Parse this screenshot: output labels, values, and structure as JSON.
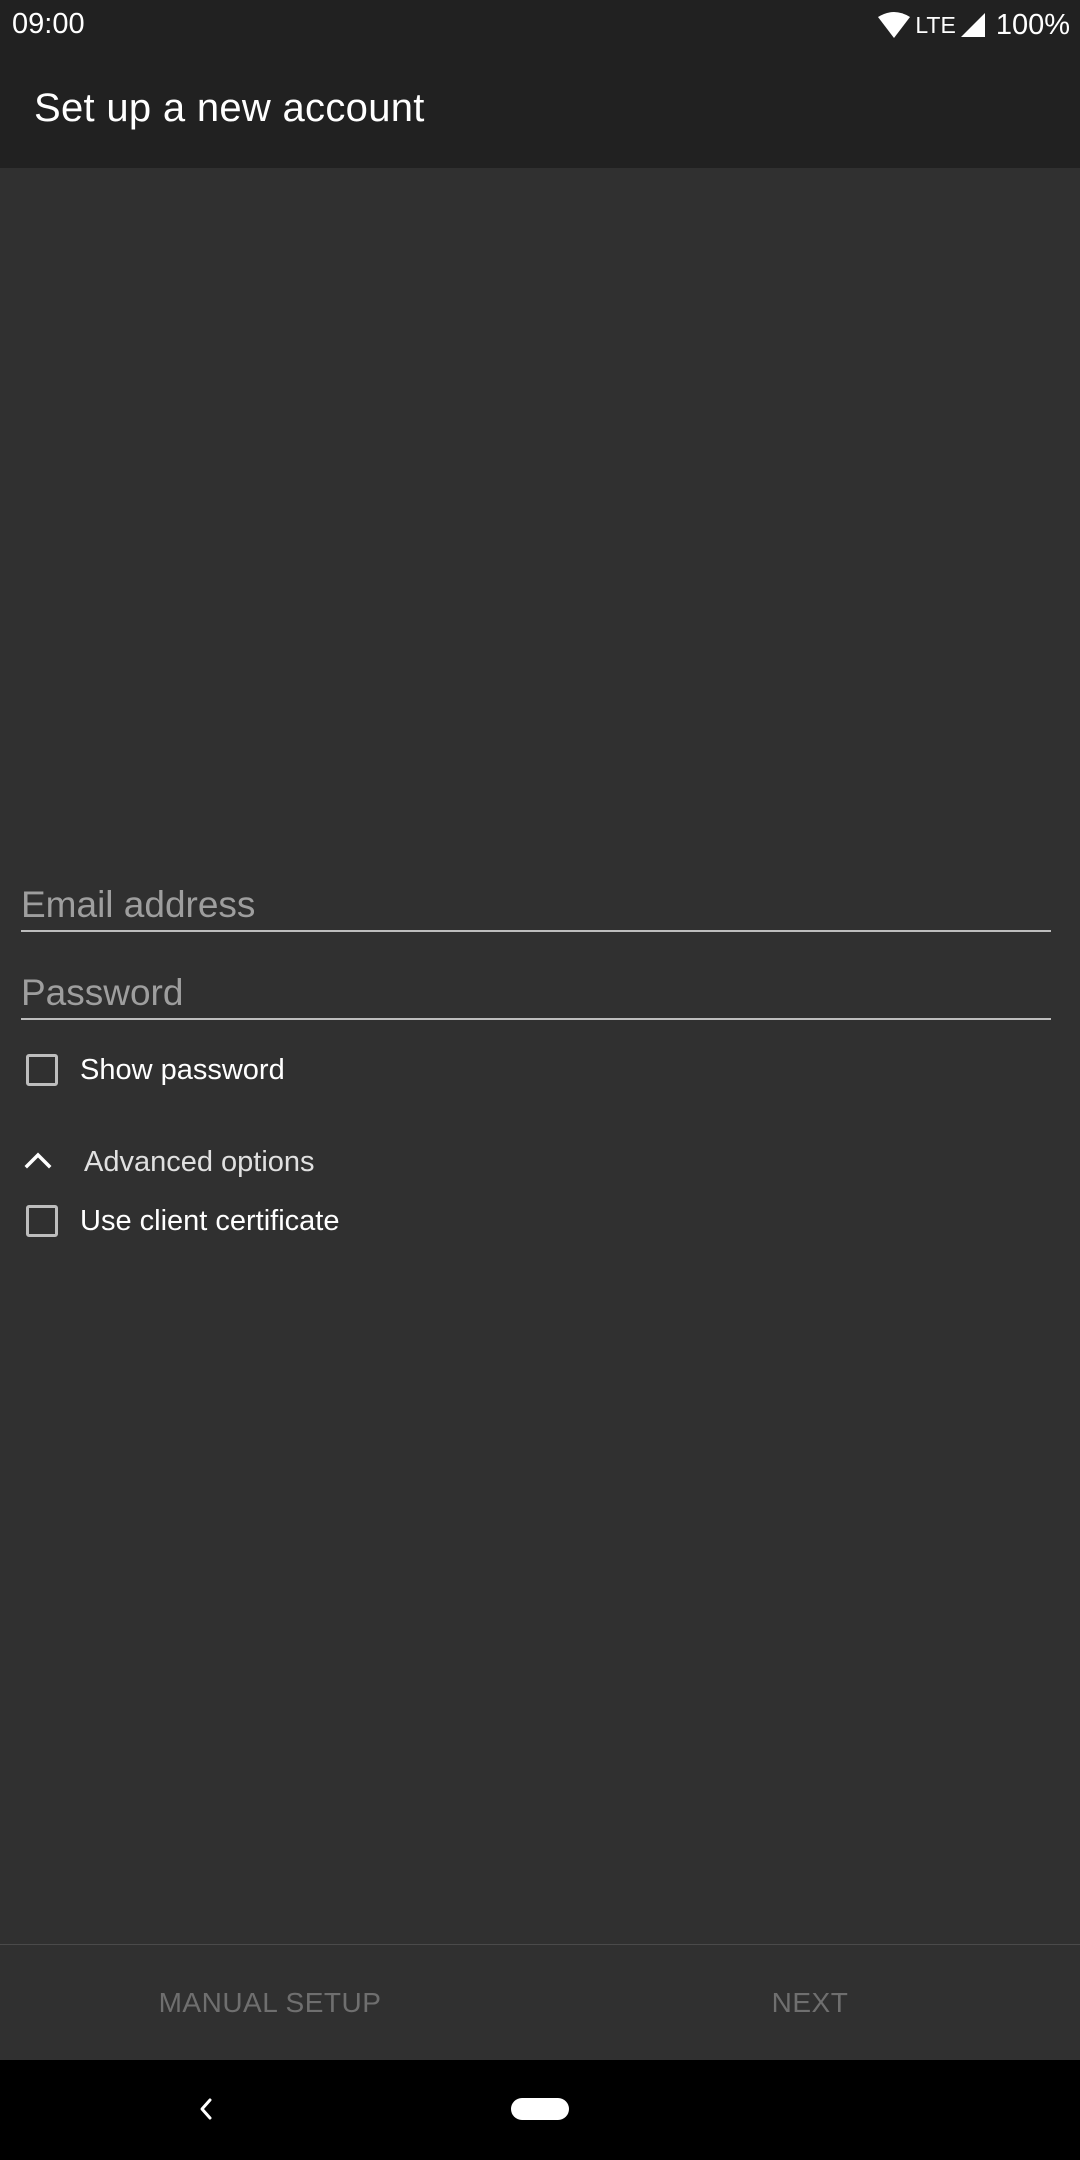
{
  "status_bar": {
    "time": "09:00",
    "network": "LTE",
    "battery": "100%",
    "icons": [
      "wifi-icon",
      "cell-signal-icon"
    ]
  },
  "app_bar": {
    "title": "Set up a new account"
  },
  "form": {
    "email": {
      "placeholder": "Email address",
      "value": ""
    },
    "password": {
      "placeholder": "Password",
      "value": ""
    },
    "show_password_label": "Show password",
    "advanced_options_label": "Advanced options",
    "client_certificate_label": "Use client certificate"
  },
  "actions": {
    "manual_setup_label": "MANUAL SETUP",
    "next_label": "NEXT"
  },
  "colors": {
    "background": "#303030",
    "app_bar": "#212121",
    "text_primary": "#ffffff",
    "text_hint": "#9e9e9e",
    "disabled_action": "#6f6f6f"
  }
}
